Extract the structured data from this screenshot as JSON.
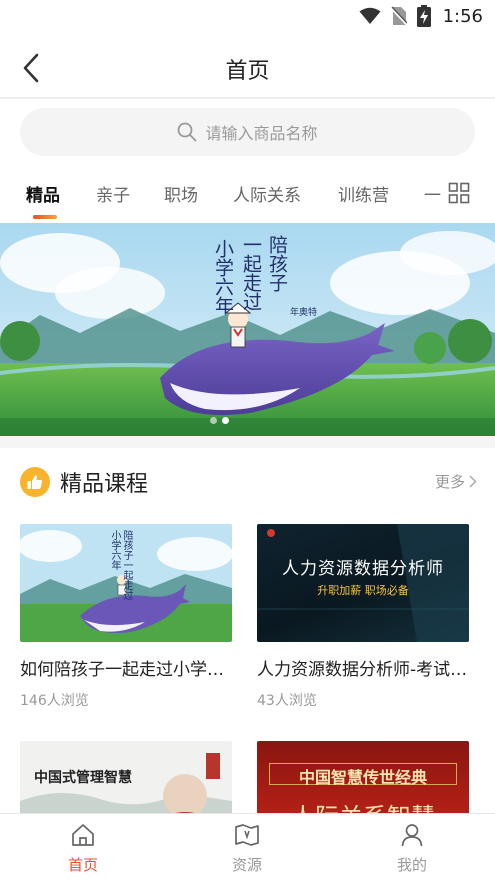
{
  "status_bar": {
    "time": "1:56",
    "icons": [
      "wifi-icon",
      "no-sim-icon",
      "battery-charging-icon"
    ]
  },
  "header": {
    "title": "首页",
    "back_icon": "chevron-left-icon"
  },
  "search": {
    "placeholder": "请输入商品名称",
    "icon": "search-icon"
  },
  "tabs": {
    "items": [
      {
        "label": "精品",
        "active": true
      },
      {
        "label": "亲子",
        "active": false
      },
      {
        "label": "职场",
        "active": false
      },
      {
        "label": "人际关系",
        "active": false
      },
      {
        "label": "训练营",
        "active": false
      },
      {
        "label": "一",
        "active": false
      }
    ],
    "grid_icon": "grid-icon"
  },
  "banner": {
    "text_col1": "陪孩子",
    "text_col2": "一起走过",
    "text_col3": "小学六年",
    "brand": "年奥特",
    "slides": 2,
    "active_slide": 1
  },
  "section": {
    "title": "精品课程",
    "more": "更多",
    "icon": "thumbs-up-icon"
  },
  "courses": [
    {
      "title": "如何陪孩子一起走过小学六年",
      "views": "146人浏览",
      "thumb_text": "陪孩子一起走过小学六年"
    },
    {
      "title": "人力资源数据分析师-考试培训",
      "views": "43人浏览",
      "thumb_text": "人力资源数据分析师",
      "thumb_sub": "升职加薪  职场必备"
    },
    {
      "title": "",
      "views": "",
      "thumb_text": "中国式管理智慧"
    },
    {
      "title": "",
      "views": "",
      "thumb_text": "中国智慧传世经典",
      "thumb_sub": "人际关系智慧"
    }
  ],
  "bottom_nav": [
    {
      "label": "首页",
      "icon": "home-icon",
      "active": true
    },
    {
      "label": "资源",
      "icon": "map-book-icon",
      "active": false
    },
    {
      "label": "我的",
      "icon": "user-icon",
      "active": false
    }
  ],
  "colors": {
    "accent": "#e8502a",
    "accent_gradient_end": "#f4a23a",
    "section_icon_bg": "#f8b52c",
    "muted_text": "#999999"
  }
}
